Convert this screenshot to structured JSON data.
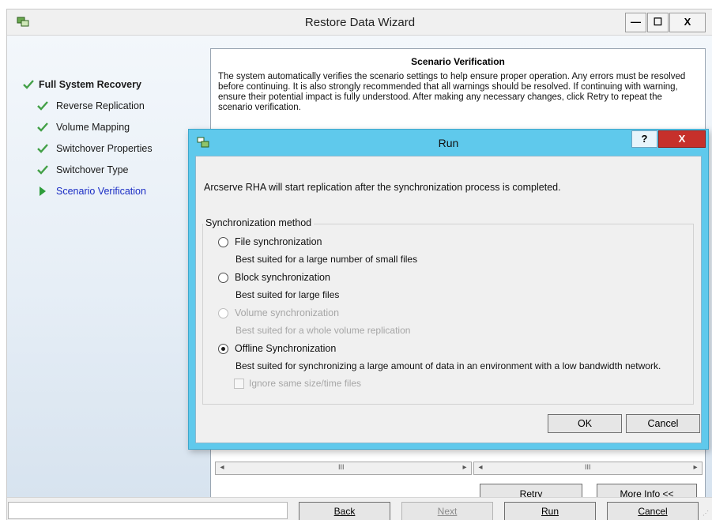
{
  "wizard": {
    "title": "Restore Data Wizard",
    "controls": {
      "minimize": "—",
      "maximize": "☐",
      "close": "X"
    },
    "steps": [
      {
        "label": "Full System Recovery",
        "status": "done",
        "level": "top"
      },
      {
        "label": "Reverse Replication",
        "status": "done",
        "level": "sub"
      },
      {
        "label": "Volume Mapping",
        "status": "done",
        "level": "sub"
      },
      {
        "label": "Switchover Properties",
        "status": "done",
        "level": "sub"
      },
      {
        "label": "Switchover Type",
        "status": "done",
        "level": "sub"
      },
      {
        "label": "Scenario Verification",
        "status": "current",
        "level": "sub"
      }
    ],
    "content": {
      "heading": "Scenario Verification",
      "description": "The system automatically verifies the scenario settings to help ensure proper operation. Any errors must be resolved before continuing. It is also strongly recommended that all warnings should be resolved. If continuing with warning, ensure their potential impact is fully understood. After making any necessary changes, click Retry to repeat the scenario verification.",
      "scroll_grip": "III",
      "retry_label": "Retry",
      "more_info_label": "More Info <<"
    },
    "footer": {
      "status_text": "",
      "back_label": "Back",
      "next_label": "Next",
      "run_label": "Run",
      "cancel_label": "Cancel"
    },
    "colors": {
      "step_done": "#43a047",
      "step_current_text": "#1a2cc4",
      "step_current_arrow": "#2e9d3b"
    }
  },
  "dialog": {
    "title": "Run",
    "help_label": "?",
    "close_label": "X",
    "message": "Arcserve RHA will start replication after the synchronization process is completed.",
    "group_label": "Synchronization method",
    "options": [
      {
        "label": "File synchronization",
        "description": "Best suited for a large number of small files",
        "selected": false,
        "enabled": true
      },
      {
        "label": "Block synchronization",
        "description": "Best suited for large files",
        "selected": false,
        "enabled": true
      },
      {
        "label": "Volume synchronization",
        "description": "Best suited for a whole volume replication",
        "selected": false,
        "enabled": false
      },
      {
        "label": "Offline Synchronization",
        "description": "Best suited for synchronizing a large amount of data in an environment with a low bandwidth network.",
        "selected": true,
        "enabled": true
      }
    ],
    "ignore_checkbox": {
      "label": "Ignore same size/time files",
      "checked": false,
      "enabled": false
    },
    "ok_label": "OK",
    "cancel_label": "Cancel",
    "colors": {
      "titlebar": "#5fc9ec",
      "close": "#c6302b"
    }
  }
}
